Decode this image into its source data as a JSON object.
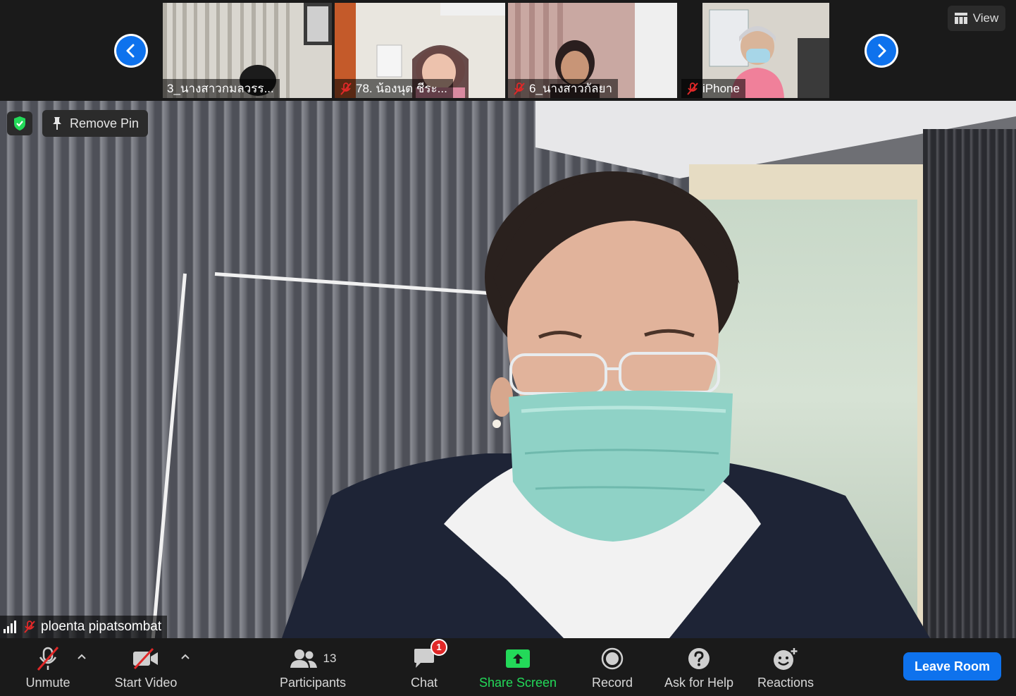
{
  "strip": {
    "thumbnails": [
      {
        "name": "3_นางสาวกมลวรร...",
        "muted": false
      },
      {
        "name": "78. น้องนุต ชีระ...",
        "muted": true
      },
      {
        "name": "6_นางสาวกัลยา",
        "muted": true
      },
      {
        "name": "iPhone",
        "muted": true
      }
    ],
    "view_label": "View"
  },
  "main": {
    "remove_pin_label": "Remove Pin",
    "speaker_name": "ploenta pipatsombat"
  },
  "toolbar": {
    "unmute_label": "Unmute",
    "start_video_label": "Start Video",
    "participants_label": "Participants",
    "participants_count": "13",
    "chat_label": "Chat",
    "chat_badge": "1",
    "share_label": "Share Screen",
    "record_label": "Record",
    "help_label": "Ask for Help",
    "reactions_label": "Reactions",
    "leave_label": "Leave Room"
  },
  "colors": {
    "accent_blue": "#0e72ed",
    "share_green": "#23d959",
    "badge_red": "#e02828",
    "muted_red": "#e02828"
  }
}
